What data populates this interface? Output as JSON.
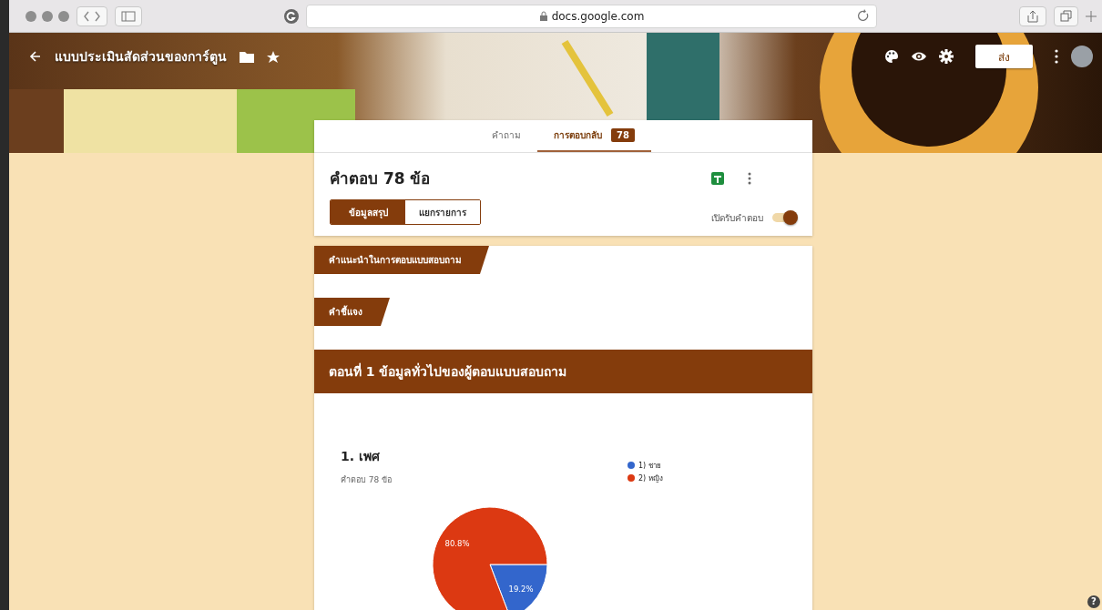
{
  "browser": {
    "url": "docs.google.com"
  },
  "header": {
    "title": "แบบประเมินสัดส่วนของการ์ตูน",
    "send_button": "ส่ง"
  },
  "tabs": [
    {
      "label": "คำถาม",
      "selected": false
    },
    {
      "label": "การตอบกลับ",
      "selected": true,
      "badge": "78"
    }
  ],
  "summary": {
    "title": "คำตอบ 78 ข้อ",
    "views": [
      {
        "label": "ข้อมูลสรุป",
        "selected": true
      },
      {
        "label": "แยกรายการ",
        "selected": false
      }
    ],
    "accepting": {
      "label": "เปิดรับคำตอบ",
      "on": true
    }
  },
  "sections": [
    {
      "kind": "tag",
      "title": "คำแนะนำในการตอบแบบสอบถาม"
    },
    {
      "kind": "tag",
      "title": "คำชี้แจง"
    },
    {
      "kind": "banner",
      "title": "ตอนที่ 1 ข้อมูลทั่วไปของผู้ตอบแบบสอบถาม"
    }
  ],
  "question": {
    "title": "1. เพศ",
    "subtitle": "คำตอบ 78 ข้อ",
    "slices": [
      {
        "color": "#3366cc"
      },
      {
        "color": "#dc3912"
      }
    ],
    "chart_data": {
      "type": "pie",
      "categories": [
        "1) ชาย",
        "2) หญิง"
      ],
      "series": [
        {
          "values": [
            19.2,
            80.8
          ]
        }
      ],
      "value_labels": [
        "19.2%",
        "80.8%"
      ],
      "legend": "right"
    }
  },
  "help": "?"
}
